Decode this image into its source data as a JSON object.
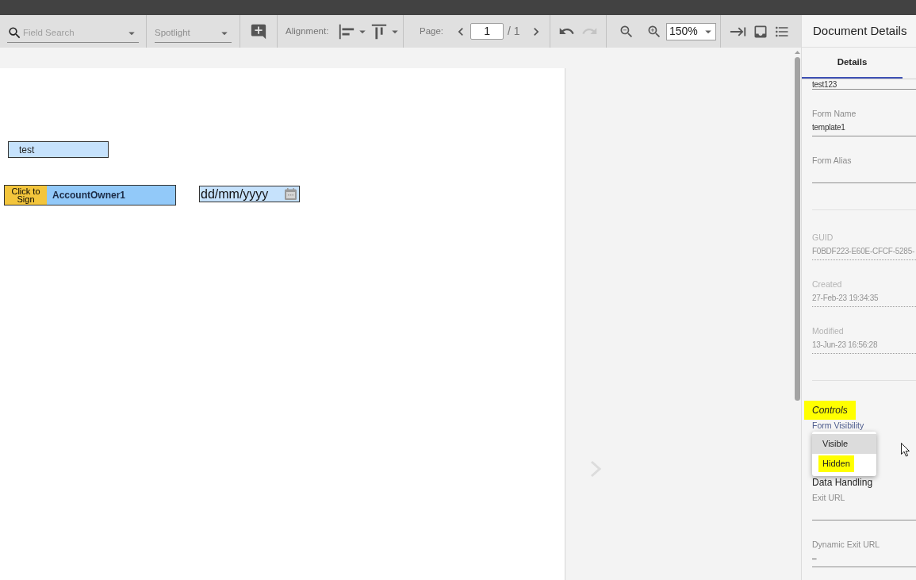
{
  "toolbar": {
    "field_search": {
      "placeholder": "Field Search"
    },
    "spotlight": {
      "placeholder": "Spotlight"
    },
    "alignment": {
      "label": "Alignment:"
    },
    "page": {
      "label": "Page:",
      "value": "1",
      "total": "/ 1"
    },
    "undo": {
      "disabled": false
    },
    "redo": {
      "disabled": true
    },
    "zoom": {
      "value": "150%"
    }
  },
  "document": {
    "fields": [
      {
        "kind": "text",
        "value": "test"
      },
      {
        "kind": "signature",
        "action": "Click to Sign",
        "signer": "AccountOwner1"
      },
      {
        "kind": "date",
        "placeholder": "dd/mm/yyyy"
      }
    ]
  },
  "panel": {
    "title": "Document Details",
    "tabs": [
      {
        "label": "Details",
        "selected": true
      }
    ],
    "sections": [
      {
        "fields": [
          {
            "value": "test123",
            "read_only": false
          },
          {
            "label": "Form Name",
            "value": "template1",
            "read_only": false
          },
          {
            "label": "Form Alias",
            "read_only": false
          }
        ]
      },
      {
        "fields": [
          {
            "label": "GUID",
            "value": "F0BDF223-E60E-CFCF-5285-",
            "read_only": true
          },
          {
            "label": "Created",
            "value": "27-Feb-23 19:34:35",
            "read_only": true
          },
          {
            "label": "Modified",
            "value": "13-Jun-23 16:56:28",
            "read_only": true
          }
        ]
      }
    ],
    "controls": {
      "title": "Controls",
      "highlighted": true,
      "visibility": {
        "label": "Form Visibility",
        "options": [
          {
            "label": "Visible",
            "selected": true,
            "highlighted": false
          },
          {
            "label": "Hidden",
            "selected": false,
            "highlighted": true
          }
        ]
      },
      "subheading": "Data Handling",
      "fields": [
        {
          "label": "Exit URL",
          "read_only": false
        },
        {
          "label": "Dynamic Exit URL",
          "value": "–",
          "read_only": false
        }
      ]
    }
  }
}
